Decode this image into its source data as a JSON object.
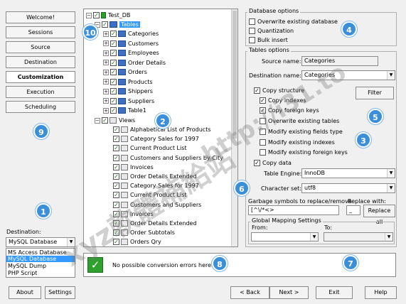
{
  "nav": {
    "welcome": "Welcome!",
    "sessions": "Sessions",
    "source": "Source",
    "destination": "Destination",
    "customization": "Customization",
    "execution": "Execution",
    "scheduling": "Scheduling"
  },
  "destination_panel": {
    "label": "Destination:",
    "selected": "MySQL Database",
    "options": [
      "MS Access Database",
      "MySQL Database",
      "MySQL Dump",
      "PHP Script"
    ]
  },
  "tree": {
    "root": "Test_DB",
    "tables_label": "Tables",
    "tables": [
      "Categories",
      "Customers",
      "Employees",
      "Order Details",
      "Orders",
      "Products",
      "Shippers",
      "Suppliers",
      "Table1"
    ],
    "views_label": "Views",
    "views": [
      "Alphabetical List of Products",
      "Category Sales for 1997",
      "Current Product List",
      "Customers and Suppliers by City",
      "Invoices",
      "Order Details Extended",
      "Category Sales for 1997",
      "Current Product List",
      "Customers and Suppliers",
      "Invoices",
      "Order Details Extended",
      "Order Subtotals",
      "Orders Qry"
    ]
  },
  "db_options": {
    "title": "Database options",
    "overwrite": "Overwrite existing database",
    "quantization": "Quantization",
    "bulk_insert": "Bulk insert"
  },
  "table_options": {
    "title": "Tables options",
    "source_name_label": "Source name:",
    "source_name": "Categories",
    "dest_name_label": "Destination name:",
    "dest_name": "Categories",
    "filter": "Filter",
    "copy_structure": "Copy structure",
    "copy_indexes": "Copy indexes",
    "copy_foreign_keys": "Copy foreign keys",
    "overwrite_tables": "Overwrite existing tables",
    "modify_fields": "Modify existing fields type",
    "modify_indexes": "Modify existing indexes",
    "modify_fk": "Modify existing foreign keys",
    "copy_data": "Copy data",
    "engine_label": "Table Engine:",
    "engine": "InnoDB",
    "charset_label": "Character set:",
    "charset": "utf8",
    "garbage_label": "Garbage symbols to replace/remove",
    "garbage_value": "[^\\/*<>",
    "replace_with_label": "Replace with:",
    "replace_with_value": "_",
    "replace_all": "Replace all",
    "mapping_title": "Global Mapping Settings",
    "from_label": "From:",
    "to_label": "To:"
  },
  "status": {
    "message": "No possible conversion errors here."
  },
  "markers": [
    "1",
    "2",
    "3",
    "4",
    "5",
    "6",
    "7",
    "8",
    "9",
    "10"
  ],
  "footer": {
    "about": "About",
    "settings": "Settings",
    "back": "< Back",
    "next": "Next >",
    "exit": "Exit",
    "help": "Help"
  },
  "watermark": {
    "text1": "http://i31.to",
    "text2": "xyz軟體補給站"
  }
}
